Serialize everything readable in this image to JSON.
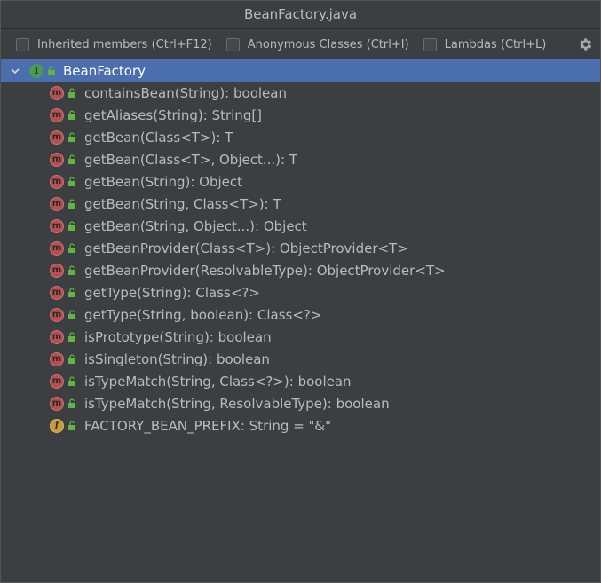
{
  "window": {
    "title": "BeanFactory.java"
  },
  "toolbar": {
    "checkboxes": [
      {
        "label": "Inherited members (Ctrl+F12)",
        "checked": false
      },
      {
        "label": "Anonymous Classes (Ctrl+I)",
        "checked": false
      },
      {
        "label": "Lambdas (Ctrl+L)",
        "checked": false
      }
    ],
    "settings_icon": "gear-icon"
  },
  "tree": {
    "root": {
      "label": "BeanFactory",
      "icon": "interface-icon",
      "expanded": true,
      "selected": true
    },
    "members": [
      {
        "label": "containsBean(String): boolean",
        "kind": "method"
      },
      {
        "label": "getAliases(String): String[]",
        "kind": "method"
      },
      {
        "label": "getBean(Class<T>): T",
        "kind": "method"
      },
      {
        "label": "getBean(Class<T>, Object...): T",
        "kind": "method"
      },
      {
        "label": "getBean(String): Object",
        "kind": "method"
      },
      {
        "label": "getBean(String, Class<T>): T",
        "kind": "method"
      },
      {
        "label": "getBean(String, Object...): Object",
        "kind": "method"
      },
      {
        "label": "getBeanProvider(Class<T>): ObjectProvider<T>",
        "kind": "method"
      },
      {
        "label": "getBeanProvider(ResolvableType): ObjectProvider<T>",
        "kind": "method"
      },
      {
        "label": "getType(String): Class<?>",
        "kind": "method"
      },
      {
        "label": "getType(String, boolean): Class<?>",
        "kind": "method"
      },
      {
        "label": "isPrototype(String): boolean",
        "kind": "method"
      },
      {
        "label": "isSingleton(String): boolean",
        "kind": "method"
      },
      {
        "label": "isTypeMatch(String, Class<?>): boolean",
        "kind": "method"
      },
      {
        "label": "isTypeMatch(String, ResolvableType): boolean",
        "kind": "method"
      },
      {
        "label": "FACTORY_BEAN_PREFIX: String = \"&\"",
        "kind": "field"
      }
    ],
    "icon_letters": {
      "method": "m",
      "field": "f",
      "interface": "I"
    }
  },
  "colors": {
    "background": "#3c3f41",
    "selection": "#4b6eaf",
    "method_icon": "#b65050",
    "field_icon": "#c89a3c",
    "interface_icon": "#499c54",
    "lock_green": "#62b543"
  }
}
